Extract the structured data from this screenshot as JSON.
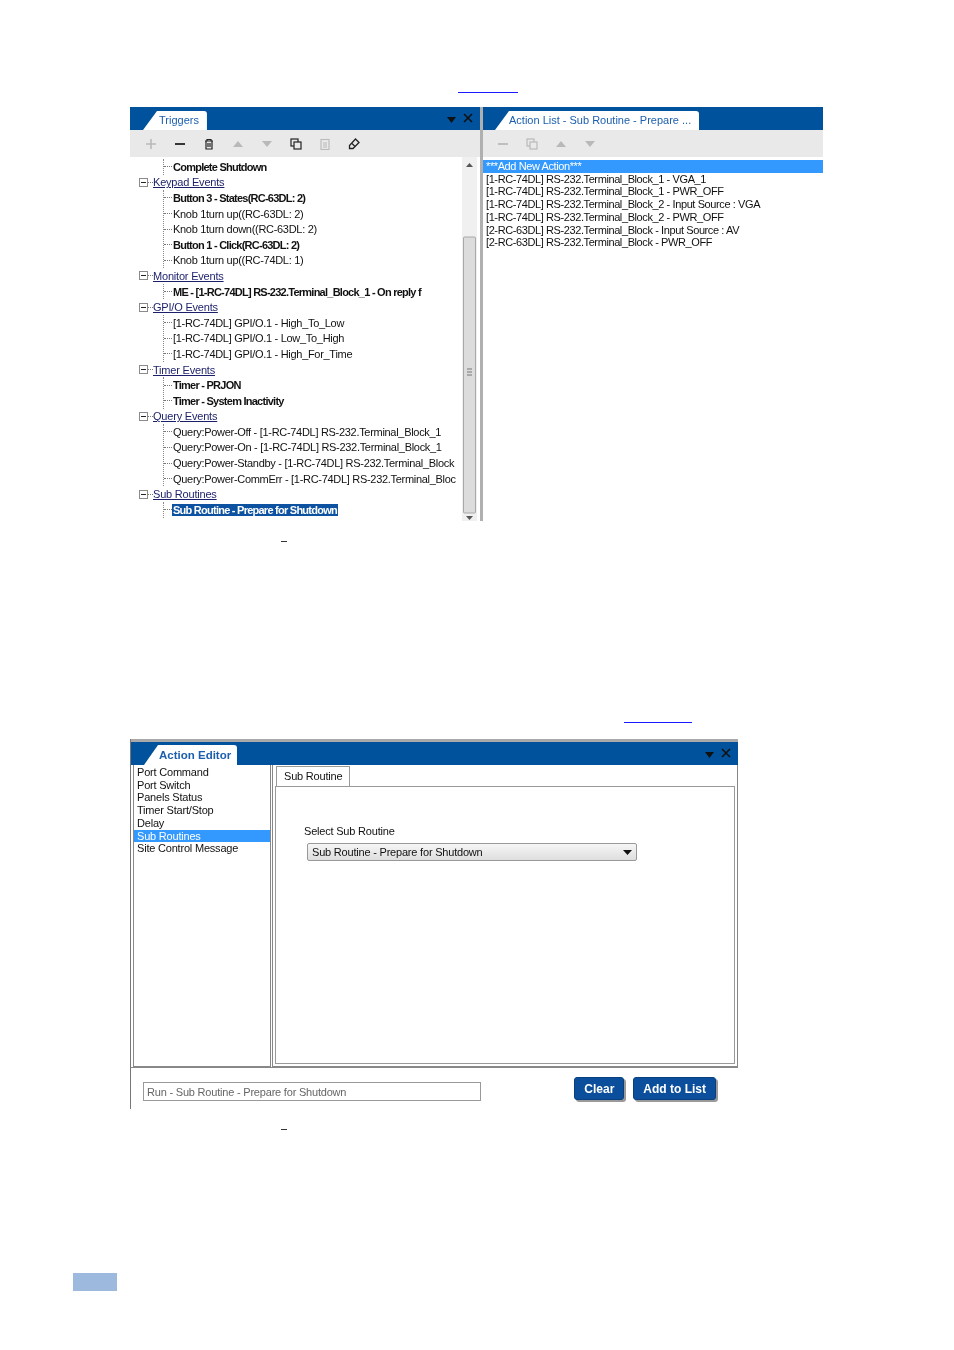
{
  "triggers_panel": {
    "tab": "Triggers",
    "toolbar": [
      {
        "kind": "add",
        "disabled": true
      },
      {
        "kind": "remove",
        "disabled": false
      },
      {
        "kind": "delete",
        "disabled": false
      },
      {
        "kind": "move_up",
        "disabled": true
      },
      {
        "kind": "move_down",
        "disabled": true
      },
      {
        "kind": "copy",
        "disabled": false
      },
      {
        "kind": "paste",
        "disabled": true
      },
      {
        "kind": "edit",
        "disabled": false
      }
    ],
    "tree": {
      "continued_children": [
        {
          "label": "Complete Shutdown",
          "bold": true,
          "selected": false
        }
      ],
      "groups": [
        {
          "label": "Keypad Events",
          "expanded": true,
          "children": [
            {
              "label": "Button 3 - States(RC-63DL: 2)",
              "bold": true,
              "selected": false
            },
            {
              "label": "Knob 1turn up((RC-63DL: 2)",
              "bold": false,
              "selected": false
            },
            {
              "label": "Knob 1turn down((RC-63DL: 2)",
              "bold": false,
              "selected": false
            },
            {
              "label": "Button 1 - Click(RC-63DL: 2)",
              "bold": true,
              "selected": false
            },
            {
              "label": "Knob 1turn up((RC-74DL: 1)",
              "bold": false,
              "selected": false
            }
          ]
        },
        {
          "label": "Monitor Events",
          "expanded": true,
          "children": [
            {
              "label": "ME - [1-RC-74DL] RS-232.Terminal_Block_1 - On reply f",
              "bold": true,
              "selected": false
            }
          ]
        },
        {
          "label": "GPI/O Events",
          "expanded": true,
          "children": [
            {
              "label": "[1-RC-74DL] GPI/O.1 - High_To_Low",
              "bold": false,
              "selected": false
            },
            {
              "label": "[1-RC-74DL] GPI/O.1 - Low_To_High",
              "bold": false,
              "selected": false
            },
            {
              "label": "[1-RC-74DL] GPI/O.1 - High_For_Time",
              "bold": false,
              "selected": false
            }
          ]
        },
        {
          "label": "Timer Events",
          "expanded": true,
          "children": [
            {
              "label": "Timer - PRJON",
              "bold": true,
              "selected": false
            },
            {
              "label": "Timer - System Inactivity",
              "bold": true,
              "selected": false
            }
          ]
        },
        {
          "label": "Query Events",
          "expanded": true,
          "children": [
            {
              "label": "Query:Power-Off - [1-RC-74DL] RS-232.Terminal_Block_1",
              "bold": false,
              "selected": false
            },
            {
              "label": "Query:Power-On - [1-RC-74DL] RS-232.Terminal_Block_1",
              "bold": false,
              "selected": false
            },
            {
              "label": "Query:Power-Standby - [1-RC-74DL] RS-232.Terminal_Block",
              "bold": false,
              "selected": false
            },
            {
              "label": "Query:Power-CommErr - [1-RC-74DL] RS-232.Terminal_Bloc",
              "bold": false,
              "selected": false
            }
          ]
        },
        {
          "label": "Sub Routines",
          "expanded": true,
          "children": [
            {
              "label": "Sub Routine - Prepare for Shutdown",
              "bold": true,
              "selected": true
            }
          ]
        }
      ]
    }
  },
  "action_list_panel": {
    "tab": "Action List - Sub Routine - Prepare ...",
    "toolbar": [
      {
        "kind": "remove",
        "disabled": true
      },
      {
        "kind": "copy",
        "disabled": true
      },
      {
        "kind": "move_up",
        "disabled": true
      },
      {
        "kind": "move_down",
        "disabled": true
      }
    ],
    "items": [
      {
        "label": "***Add New Action***",
        "selected": true
      },
      {
        "label": "[1-RC-74DL] RS-232.Terminal_Block_1 - VGA_1",
        "selected": false
      },
      {
        "label": "[1-RC-74DL] RS-232.Terminal_Block_1 - PWR_OFF",
        "selected": false
      },
      {
        "label": "[1-RC-74DL] RS-232.Terminal_Block_2 - Input Source : VGA",
        "selected": false
      },
      {
        "label": "[1-RC-74DL] RS-232.Terminal_Block_2 - PWR_OFF",
        "selected": false
      },
      {
        "label": "[2-RC-63DL] RS-232.Terminal_Block - Input Source : AV",
        "selected": false
      },
      {
        "label": "[2-RC-63DL] RS-232.Terminal_Block - PWR_OFF",
        "selected": false
      }
    ]
  },
  "action_editor": {
    "tab": "Action Editor",
    "action_types": [
      {
        "label": "Port Command",
        "selected": false
      },
      {
        "label": "Port Switch",
        "selected": false
      },
      {
        "label": "Panels Status",
        "selected": false
      },
      {
        "label": "Timer Start/Stop",
        "selected": false
      },
      {
        "label": "Delay",
        "selected": false
      },
      {
        "label": "Sub Routines",
        "selected": true
      },
      {
        "label": "Site Control Message",
        "selected": false
      }
    ],
    "detail_tab": "Sub Routine",
    "select_label": "Select Sub Routine",
    "select_value": "Sub Routine - Prepare for Shutdown",
    "command_field": {
      "value": "Run - Sub Routine - Prepare for Shutdown"
    },
    "buttons": [
      {
        "label": "Clear"
      },
      {
        "label": "Add to List"
      }
    ]
  }
}
